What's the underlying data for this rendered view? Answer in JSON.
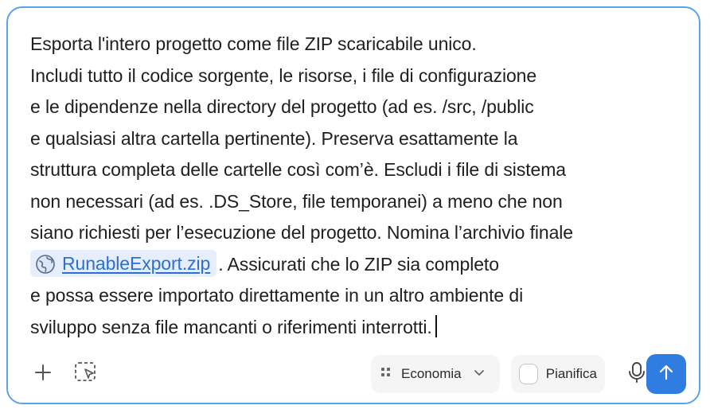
{
  "prompt": {
    "lines": [
      "Esporta l'intero progetto come file ZIP scaricabile unico.",
      "Includi tutto il codice sorgente, le risorse, i file di configurazione",
      "e le dipendenze nella directory del progetto (ad es. /src, /public",
      "e qualsiasi altra cartella pertinente). Preserva esattamente la",
      "struttura completa delle cartelle così com’è. Escludi i file di sistema",
      "non necessari (ad es. .DS_Store, file temporanei) a meno che non",
      "siano richiesti per l’esecuzione del progetto. Nomina l’archivio finale"
    ],
    "chip_label": "RunableExport.zip",
    "chip_icon": "globe-icon",
    "after_chip": ". Assicurati che lo ZIP sia completo",
    "tail_lines": [
      "e possa essere importato direttamente in un altro ambiente di",
      "sviluppo senza file mancanti o riferimenti interrotti."
    ]
  },
  "toolbar": {
    "add_icon": "plus-icon",
    "capture_icon": "screen-capture-icon",
    "model_label": "Economia",
    "model_icon": "grid-dots-icon",
    "plan_label": "Pianifica",
    "mic_icon": "microphone-icon",
    "send_icon": "arrow-up-icon"
  },
  "colors": {
    "border": "#5aa2ea",
    "accent": "#2f7de1",
    "link": "#2a6fd6",
    "chip_bg": "#e6eefb"
  }
}
